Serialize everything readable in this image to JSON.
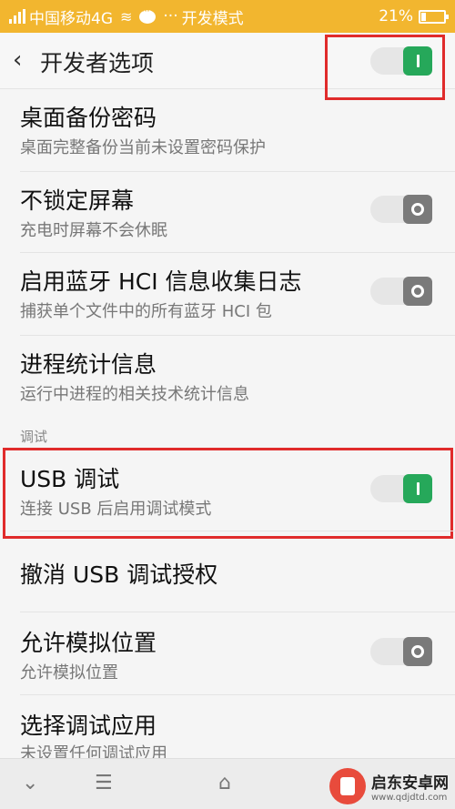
{
  "status_bar": {
    "carrier": "中国移动4G",
    "mode": "开发模式",
    "battery": "21%",
    "battery_level": 0.21
  },
  "header": {
    "title": "开发者选项",
    "master_switch_on": true
  },
  "rows": [
    {
      "title": "桌面备份密码",
      "subtitle": "桌面完整备份当前未设置密码保护"
    },
    {
      "title": "不锁定屏幕",
      "subtitle": "充电时屏幕不会休眠",
      "switch_on": false
    },
    {
      "title": "启用蓝牙 HCI 信息收集日志",
      "subtitle": "捕获单个文件中的所有蓝牙 HCI 包",
      "switch_on": false
    },
    {
      "title": "进程统计信息",
      "subtitle": "运行中进程的相关技术统计信息"
    }
  ],
  "section_debug": "调试",
  "debug_rows": [
    {
      "title": "USB 调试",
      "subtitle": "连接 USB 后启用调试模式",
      "switch_on": true
    },
    {
      "title": "撤消 USB 调试授权"
    },
    {
      "title": "允许模拟位置",
      "subtitle": "允许模拟位置",
      "switch_on": false
    },
    {
      "title": "选择调试应用",
      "subtitle": "未设置任何调试应用"
    }
  ],
  "nav": {
    "icons": [
      "chevron-down-icon",
      "menu-icon",
      "home-icon"
    ]
  },
  "watermark": {
    "name": "启东安卓网",
    "url": "www.qdjdtd.com"
  },
  "colors": {
    "status_bar": "#f2b62f",
    "switch_on": "#26a85a",
    "switch_off": "#7a7a7a",
    "highlight": "#e02b2b"
  }
}
